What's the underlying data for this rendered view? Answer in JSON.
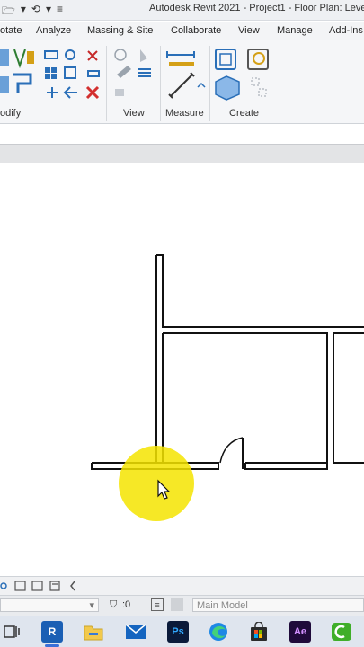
{
  "app": {
    "title": "Autodesk Revit 2021 - Project1 - Floor Plan: Leve"
  },
  "ribbon_tabs": [
    "otate",
    "Analyze",
    "Massing & Site",
    "Collaborate",
    "View",
    "Manage",
    "Add-Ins"
  ],
  "panels": {
    "modify": "odify",
    "view": "View",
    "measure": "Measure",
    "create": "Create"
  },
  "statusbar": {
    "selection_count": ":0",
    "workset": "Main Model"
  },
  "colors": {
    "cursor_highlight": "#f5e400",
    "taskbar_active": "#3a6fd8",
    "revit_blue": "#1a5fb4"
  },
  "icons": {
    "qat": [
      "open-icon",
      "dropdown-icon",
      "more-icon"
    ],
    "taskbar": [
      "task-view-icon",
      "revit-icon",
      "file-explorer-icon",
      "mail-icon",
      "photoshop-icon",
      "edge-icon",
      "store-icon",
      "after-effects-icon",
      "camtasia-icon"
    ]
  },
  "taskbar": {
    "revit_label": "R",
    "photoshop_label": "Ps",
    "after_effects_label": "Ae"
  }
}
